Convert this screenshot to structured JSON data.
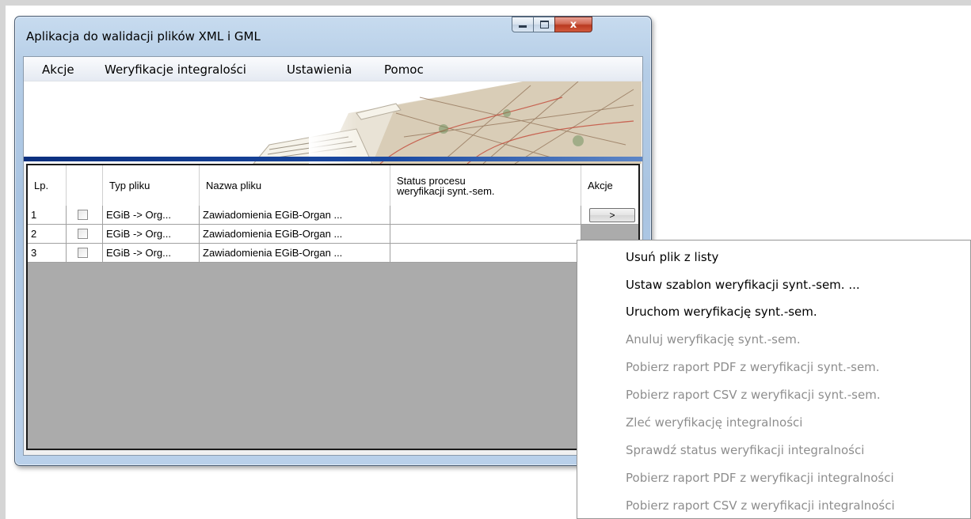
{
  "window": {
    "title": "Aplikacja do walidacji plików XML i GML",
    "controls": {
      "minimize": "",
      "maximize": "",
      "close": "x"
    }
  },
  "menu": [
    "Akcje",
    "Weryfikacje integralości",
    "Ustawienia",
    "Pomoc"
  ],
  "table": {
    "columns": [
      "Lp.",
      "",
      "Typ pliku",
      "Nazwa pliku",
      "Status procesu",
      "weryfikacji synt.-sem.",
      "Akcje"
    ],
    "rows": [
      {
        "lp": "1",
        "checked": false,
        "type": "EGiB -> Org...",
        "name": "Zawiadomienia EGiB-Organ ...",
        "status": "",
        "action": ">"
      },
      {
        "lp": "2",
        "checked": false,
        "type": "EGiB -> Org...",
        "name": "Zawiadomienia EGiB-Organ ...",
        "status": ""
      },
      {
        "lp": "3",
        "checked": false,
        "type": "EGiB -> Org...",
        "name": "Zawiadomienia EGiB-Organ ...",
        "status": ""
      }
    ]
  },
  "context_menu": {
    "items": [
      {
        "label": "Usuń plik z listy",
        "enabled": true
      },
      {
        "label": "Ustaw szablon weryfikacji synt.-sem. ...",
        "enabled": true
      },
      {
        "label": "Uruchom weryfikację synt.-sem.",
        "enabled": true
      },
      {
        "label": "Anuluj weryfikację synt.-sem.",
        "enabled": false
      },
      {
        "label": "Pobierz raport PDF z weryfikacji synt.-sem.",
        "enabled": false
      },
      {
        "label": "Pobierz raport CSV z weryfikacji synt.-sem.",
        "enabled": false
      },
      {
        "label": "Zleć weryfikację integralności",
        "enabled": false
      },
      {
        "label": "Sprawdź status weryfikacji integralności",
        "enabled": false
      },
      {
        "label": "Pobierz raport PDF z weryfikacji integralności",
        "enabled": false
      },
      {
        "label": "Pobierz raport CSV z weryfikacji integralności",
        "enabled": false
      }
    ]
  },
  "colors": {
    "window_frame": "#a9c4e2",
    "close_button": "#c7452a",
    "banner_stripe": "#0b2f7e",
    "grid_background": "#ababab",
    "disabled_text": "#8e8e8e"
  }
}
